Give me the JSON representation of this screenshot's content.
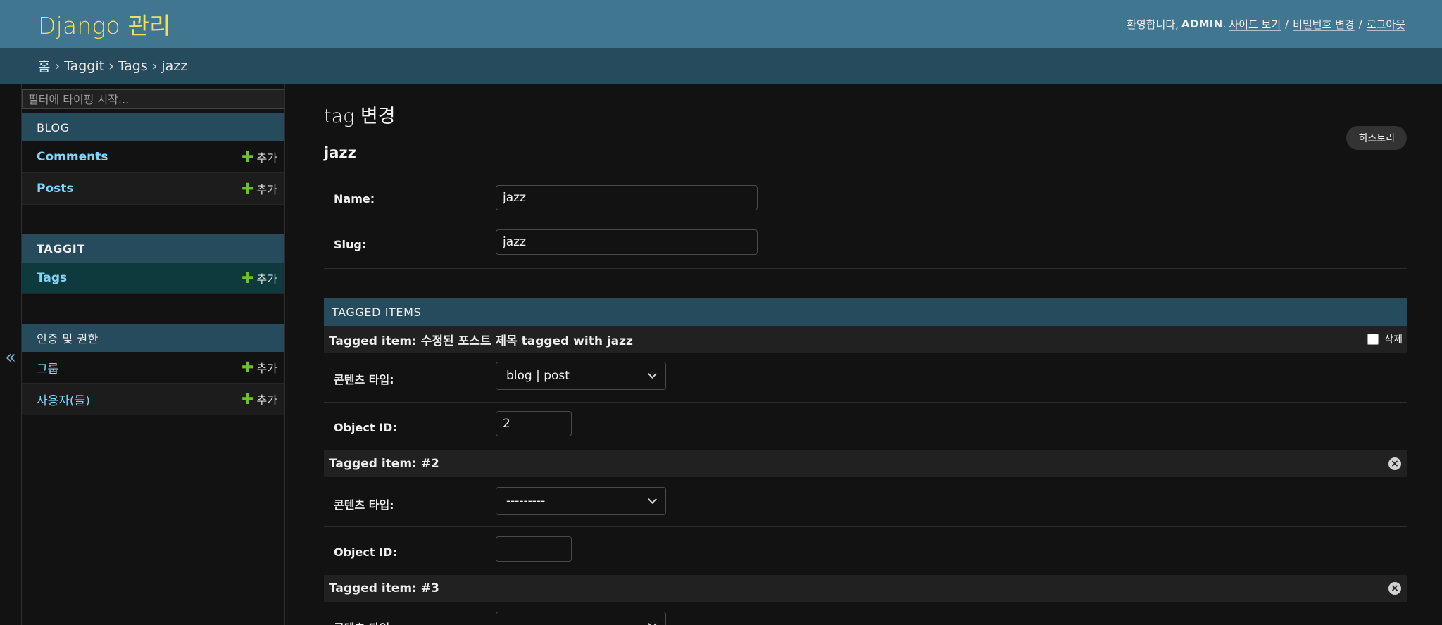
{
  "header": {
    "brand": "Django 관리",
    "welcome": "환영합니다,",
    "username": "ADMIN",
    "username_suffix": ".",
    "view_site": "사이트 보기",
    "change_password": "비밀번호 변경",
    "logout": "로그아웃",
    "separator": "/"
  },
  "breadcrumbs": {
    "items": [
      "홈",
      "Taggit",
      "Tags",
      "jazz"
    ],
    "separator": "›"
  },
  "sidebar": {
    "collapse_label": "«",
    "filter_placeholder": "필터에 타이핑 시작...",
    "add_label": "추가",
    "plus": "✚",
    "modules": [
      {
        "caption": "BLOG",
        "models": [
          "Comments",
          "Posts"
        ]
      },
      {
        "caption": "TAGGIT",
        "models": [
          "Tags"
        ]
      },
      {
        "caption": "인증 및 권한",
        "models": [
          "그룹",
          "사용자(들)"
        ]
      }
    ]
  },
  "content": {
    "page_title": "tag 변경",
    "history_button": "히스토리",
    "object_title": "jazz",
    "fields": {
      "name_label": "Name:",
      "name_value": "jazz",
      "slug_label": "Slug:",
      "slug_value": "jazz"
    },
    "inline": {
      "caption": "TAGGED ITEMS",
      "delete_label": "삭제",
      "content_type_label": "콘텐츠 타입:",
      "object_id_label": "Object ID:",
      "items": [
        {
          "title": "Tagged item: 수정된 포스트 제목 tagged with jazz",
          "content_type": "blog | post",
          "object_id": "2"
        },
        {
          "title": "Tagged item: #2",
          "content_type": "---------",
          "object_id": ""
        },
        {
          "title": "Tagged item: #3",
          "content_type": "",
          "object_id": ""
        }
      ]
    }
  },
  "colors": {
    "header_bg": "#417690",
    "breadcrumbs_bg": "#264b5d",
    "brand": "#f5dd5d",
    "link": "#81d4fa",
    "add_icon": "#70bf2b",
    "page_bg": "#121212"
  }
}
